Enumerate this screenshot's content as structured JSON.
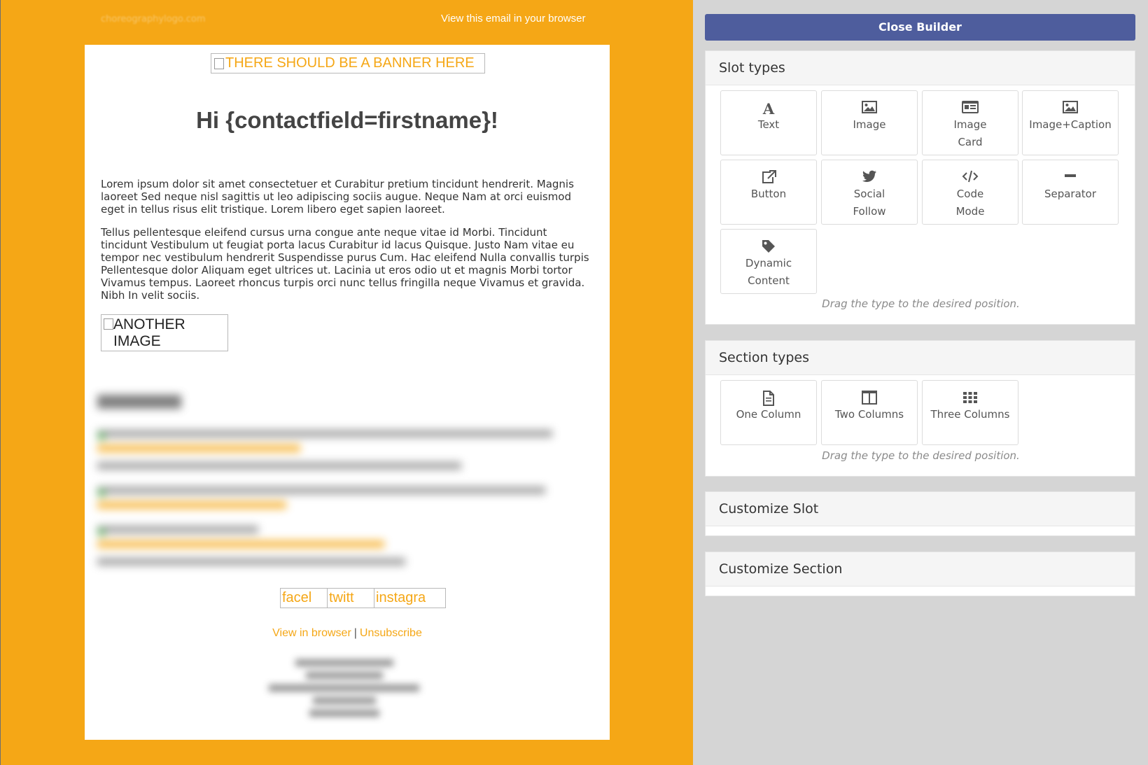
{
  "email": {
    "topbar_logo": "choreographylogo.com",
    "view_in_browser_top": "View this email in your browser",
    "banner_alt": "THERE SHOULD BE A BANNER HERE",
    "greeting": "Hi {contactfield=firstname}!",
    "paragraph1": "Lorem ipsum dolor sit amet consectetuer et Curabitur pretium tincidunt hendrerit. Magnis laoreet Sed neque nisl sagittis ut leo adipiscing sociis augue. Neque Nam at orci euismod eget in tellus risus elit tristique. Lorem libero eget sapien laoreet.",
    "paragraph2": "Tellus pellentesque eleifend cursus urna congue ante neque vitae id Morbi. Tincidunt tincidunt Vestibulum ut feugiat porta lacus Curabitur id lacus Quisque. Justo Nam vitae eu tempor nec vestibulum hendrerit Suspendisse purus Cum. Hac eleifend Nulla convallis turpis Pellentesque dolor Aliquam eget ultrices ut. Lacinia ut eros odio ut et magnis Morbi tortor Vivamus tempus. Laoreet rhoncus turpis orci nunc tellus fringilla neque Vivamus et gravida. Nibh In velit sociis.",
    "another_image_alt": "ANOTHER IMAGE",
    "social": {
      "facebook_alt": "facel",
      "twitter_alt": "twitt",
      "instagram_alt": "instagra"
    },
    "footer": {
      "view_in_browser": "View in browser",
      "separator": "|",
      "unsubscribe": "Unsubscribe"
    },
    "colors": {
      "background": "#f5a716",
      "card": "#ffffff",
      "link": "#f5a716",
      "text": "#333333"
    }
  },
  "builder": {
    "close_label": "Close Builder",
    "slot_types": {
      "title": "Slot types",
      "items": [
        {
          "label": "Text",
          "icon": "text-icon"
        },
        {
          "label": "Image",
          "icon": "image-icon"
        },
        {
          "label": "Image Card",
          "icon": "image-card-icon"
        },
        {
          "label": "Image+Caption",
          "icon": "image-caption-icon"
        },
        {
          "label": "Button",
          "icon": "external-link-icon"
        },
        {
          "label": "Social Follow",
          "icon": "twitter-icon"
        },
        {
          "label": "Code Mode",
          "icon": "code-icon"
        },
        {
          "label": "Separator",
          "icon": "minus-icon"
        },
        {
          "label": "Dynamic Content",
          "icon": "tag-icon"
        }
      ],
      "hint": "Drag the type to the desired position."
    },
    "section_types": {
      "title": "Section types",
      "items": [
        {
          "label": "One Column",
          "icon": "file-icon"
        },
        {
          "label": "Two Columns",
          "icon": "columns-icon"
        },
        {
          "label": "Three Columns",
          "icon": "grid-icon"
        }
      ],
      "hint": "Drag the type to the desired position."
    },
    "customize_slot": {
      "title": "Customize Slot"
    },
    "customize_section": {
      "title": "Customize Section"
    },
    "colors": {
      "primary_button": "#4e5d9d",
      "panel_background": "#d5d5d5",
      "header_background": "#f5f5f5"
    }
  }
}
